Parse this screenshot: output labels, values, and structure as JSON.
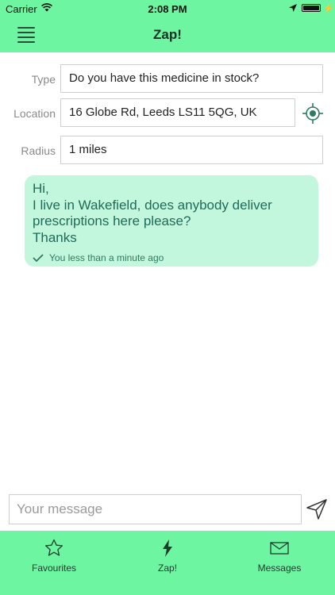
{
  "status_bar": {
    "carrier": "Carrier",
    "time": "2:08 PM"
  },
  "nav": {
    "title": "Zap!",
    "menu_icon": "hamburger-menu-icon"
  },
  "form": {
    "type": {
      "label": "Type",
      "value": "Do you have this medicine in stock?"
    },
    "location": {
      "label": "Location",
      "value": "16 Globe Rd, Leeds LS11 5QG, UK",
      "icon": "locate-target-icon"
    },
    "radius": {
      "label": "Radius",
      "value": "1 miles"
    }
  },
  "message": {
    "lines": [
      "Hi,",
      "I live in Wakefield, does anybody deliver",
      "prescriptions here please?",
      "Thanks"
    ],
    "meta": "You less than a minute ago",
    "status_icon": "check-icon"
  },
  "composer": {
    "placeholder": "Your message",
    "send_icon": "send-icon"
  },
  "tabs": [
    {
      "label": "Favourites",
      "icon": "star-icon"
    },
    {
      "label": "Zap!",
      "icon": "lightning-icon"
    },
    {
      "label": "Messages",
      "icon": "envelope-icon"
    }
  ],
  "colors": {
    "accent": "#6ef5a2",
    "bubble": "#c2f7dd",
    "bubble_text": "#1f6b5a"
  }
}
